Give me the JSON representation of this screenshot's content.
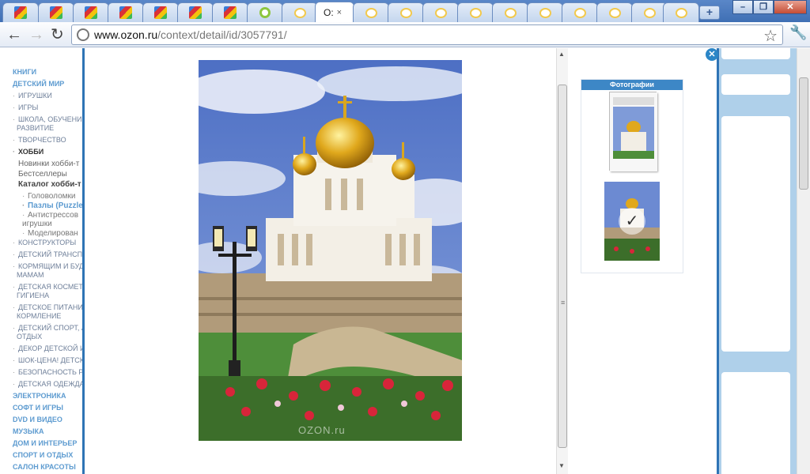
{
  "browser": {
    "active_tab_title": "O:",
    "active_tab_close": "×",
    "new_tab_label": "+",
    "window_buttons": {
      "minimize": "–",
      "maximize": "❐",
      "close": "✕"
    },
    "back": "←",
    "forward": "→",
    "reload": "↻",
    "url_host": "www.ozon.ru",
    "url_path": "/context/detail/id/3057791/",
    "star": "☆",
    "wrench": "🔧"
  },
  "sidebar": {
    "items": [
      {
        "label": "КНИГИ",
        "style": "bold"
      },
      {
        "label": "ДЕТСКИЙ МИР",
        "style": "bold"
      },
      {
        "label": "ИГРУШКИ",
        "style": "row"
      },
      {
        "label": "ИГРЫ",
        "style": "row"
      },
      {
        "label": "ШКОЛА, ОБУЧЕНИЕ И",
        "style": "row"
      },
      {
        "label": "РАЗВИТИЕ",
        "style": "cont"
      },
      {
        "label": "ТВОРЧЕСТВО",
        "style": "row"
      },
      {
        "label": "ХОББИ",
        "style": "dark"
      },
      {
        "label": "Новинки хобби-т",
        "style": "sub"
      },
      {
        "label": "Бестселлеры",
        "style": "sub"
      },
      {
        "label": "Каталог хобби-т",
        "style": "dark2"
      },
      {
        "label": "Головоломки",
        "style": "subsub"
      },
      {
        "label": "Пазлы (Puzzle",
        "style": "subsub-hl"
      },
      {
        "label": "Антистрессов",
        "style": "subsub"
      },
      {
        "label": "игрушки",
        "style": "subsub-cont"
      },
      {
        "label": "Моделирован",
        "style": "subsub"
      },
      {
        "label": "КОНСТРУКТОРЫ",
        "style": "row"
      },
      {
        "label": "ДЕТСКИЙ ТРАНСПО",
        "style": "row"
      },
      {
        "label": "КОРМЯЩИМ И БУДУ",
        "style": "row"
      },
      {
        "label": "МАМАМ",
        "style": "cont"
      },
      {
        "label": "ДЕТСКАЯ КОСМЕТИ",
        "style": "row"
      },
      {
        "label": "ГИГИЕНА",
        "style": "cont"
      },
      {
        "label": "ДЕТСКОЕ ПИТАНИЕ",
        "style": "row"
      },
      {
        "label": "КОРМЛЕНИЕ",
        "style": "cont"
      },
      {
        "label": "ДЕТСКИЙ СПОРТ, А",
        "style": "row"
      },
      {
        "label": "ОТДЫХ",
        "style": "cont"
      },
      {
        "label": "ДЕКОР ДЕТСКОЙ И",
        "style": "row"
      },
      {
        "label": "ШОК-ЦЕНА! ДЕТСК",
        "style": "row"
      },
      {
        "label": "БЕЗОПАСНОСТЬ РЕБ",
        "style": "row"
      },
      {
        "label": "ДЕТСКАЯ ОДЕЖДА",
        "style": "row"
      },
      {
        "label": "ЭЛЕКТРОНИКА",
        "style": "bold"
      },
      {
        "label": "СОФТ И ИГРЫ",
        "style": "bold"
      },
      {
        "label": "DVD И ВИДЕО",
        "style": "bold"
      },
      {
        "label": "МУЗЫКА",
        "style": "bold"
      },
      {
        "label": "ДОМ И ИНТЕРЬЕР",
        "style": "bold"
      },
      {
        "label": "СПОРТ И ОТДЫХ",
        "style": "bold"
      },
      {
        "label": "САЛОН КРАСОТЫ",
        "style": "bold"
      }
    ]
  },
  "modal": {
    "close_label": "✕",
    "watermark": "OZON.ru",
    "gallery_title": "Фотографии",
    "check_glyph": "✓",
    "scroll_up": "▲",
    "scroll_down": "▼",
    "grip": "≡"
  },
  "colors": {
    "accent": "#2e74b5",
    "link": "#5d9bd0",
    "sidebar_right": "#afd0ea"
  }
}
